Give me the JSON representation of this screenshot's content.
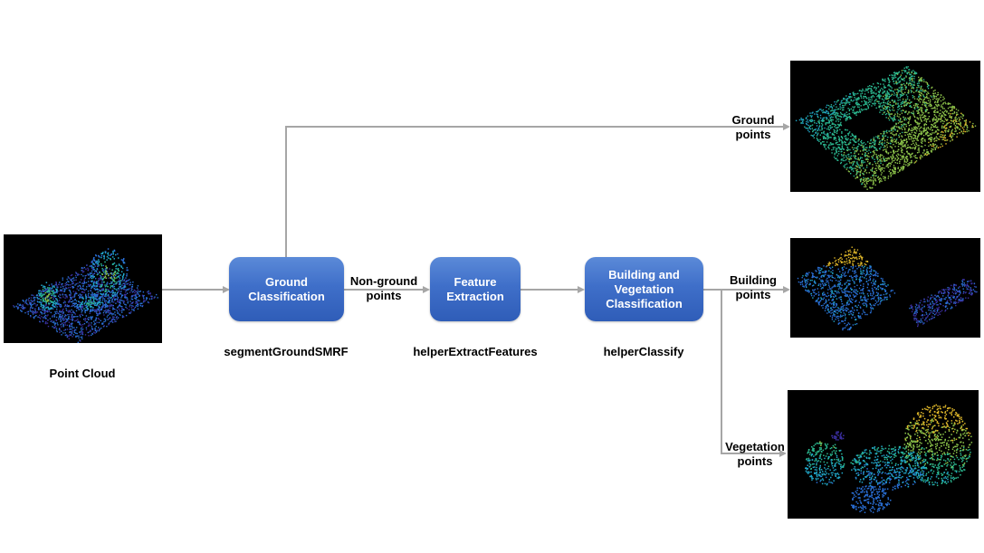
{
  "diagram": {
    "input": {
      "image_icon": "point-cloud-image",
      "caption": "Point Cloud"
    },
    "steps": [
      {
        "id": "ground-classification",
        "lines": [
          "Ground",
          "Classification"
        ],
        "function": "segmentGroundSMRF"
      },
      {
        "id": "feature-extraction",
        "lines": [
          "Feature",
          "Extraction"
        ],
        "function": "helperExtractFeatures"
      },
      {
        "id": "building-vegetation-classification",
        "lines": [
          "Building and",
          "Vegetation",
          "Classification"
        ],
        "function": "helperClassify"
      }
    ],
    "edges": {
      "non_ground": [
        "Non-ground",
        "points"
      ],
      "ground": [
        "Ground",
        "points"
      ],
      "building": [
        "Building",
        "points"
      ],
      "vegetation": [
        "Vegetation",
        "points"
      ]
    },
    "outputs": [
      {
        "name": "ground-points-image",
        "icon": "ground-point-cloud-image"
      },
      {
        "name": "building-points-image",
        "icon": "building-point-cloud-image"
      },
      {
        "name": "vegetation-points-image",
        "icon": "vegetation-point-cloud-image"
      }
    ],
    "colors": {
      "box_top": "#5b8ad8",
      "box_bottom": "#2f5db8",
      "connector": "#a6a6a6",
      "image_background": "#000000",
      "colormap": [
        "#3b2fa0",
        "#2a6fd6",
        "#21a7c9",
        "#2bb890",
        "#8cc34a",
        "#e0b82a"
      ]
    }
  }
}
